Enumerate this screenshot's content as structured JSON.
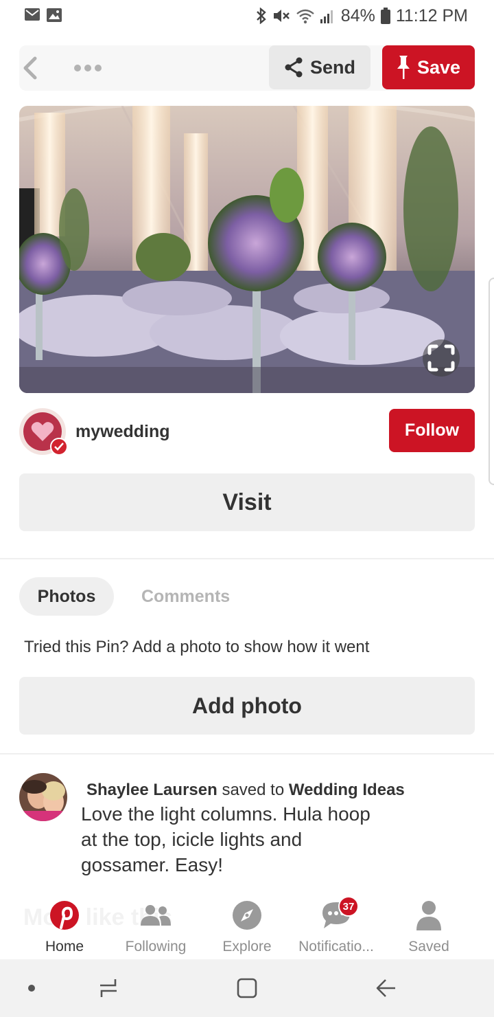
{
  "status_bar": {
    "battery": "84%",
    "time": "11:12 PM",
    "icons": [
      "mail-icon",
      "image-icon",
      "bluetooth-icon",
      "mute-icon",
      "wifi-icon",
      "signal-icon",
      "battery-icon"
    ]
  },
  "toolbar": {
    "back_icon": "chevron-left-icon",
    "more_icon": "more-dots-icon",
    "send_label": "Send",
    "save_label": "Save"
  },
  "pin": {
    "lens_icon": "visual-search-icon"
  },
  "creator": {
    "name": "mywedding",
    "follow_label": "Follow"
  },
  "visit_label": "Visit",
  "tabs": [
    {
      "label": "Photos",
      "active": true
    },
    {
      "label": "Comments",
      "active": false
    }
  ],
  "tried": {
    "prompt": "Tried this Pin? Add a photo to show how it went",
    "add_photo_label": "Add photo"
  },
  "activity": {
    "user": "Shaylee Laursen",
    "action": "saved to",
    "board": "Wedding Ideas",
    "note": "Love the light columns. Hula hoop at the top, icicle lights and gossamer. Easy!"
  },
  "ghost_heading": "More like this",
  "bottom_nav": [
    {
      "label": "Home",
      "icon": "pinterest-logo-icon",
      "active": true
    },
    {
      "label": "Following",
      "icon": "people-icon",
      "active": false
    },
    {
      "label": "Explore",
      "icon": "compass-icon",
      "active": false
    },
    {
      "label": "Notificatio...",
      "icon": "chat-bubble-icon",
      "active": false,
      "badge": "37"
    },
    {
      "label": "Saved",
      "icon": "person-icon",
      "active": false
    }
  ],
  "colors": {
    "brand_red": "#cc1424",
    "button_gray": "#efefef",
    "text_dark": "#333333",
    "text_muted": "#8e8e8e"
  }
}
